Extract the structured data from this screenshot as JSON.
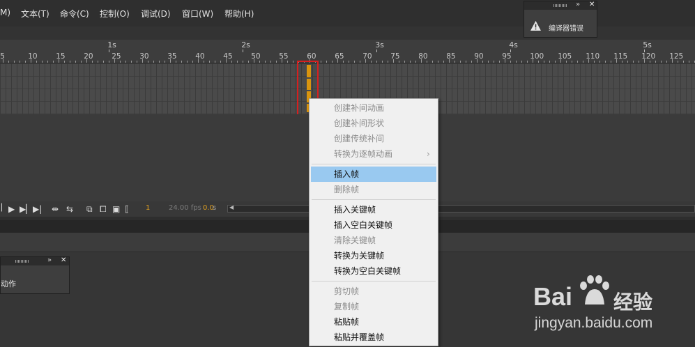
{
  "menu": [
    "M)",
    "文本(T)",
    "命令(C)",
    "控制(O)",
    "调试(D)",
    "窗口(W)",
    "帮助(H)"
  ],
  "ruler": {
    "seconds": [
      "1s",
      "2s",
      "3s",
      "4s",
      "5s"
    ],
    "frames": [
      "5",
      "10",
      "15",
      "20",
      "25",
      "30",
      "35",
      "40",
      "45",
      "50",
      "55",
      "60",
      "65",
      "70",
      "75",
      "80",
      "85",
      "90",
      "95",
      "100",
      "105",
      "110",
      "115",
      "120",
      "125"
    ]
  },
  "controls": {
    "frame": "1",
    "fps": "24.00 fps",
    "time": "0.0",
    "time_unit": "s"
  },
  "compiler_panel": {
    "title": "编译器错误",
    "collapse": "»",
    "close": "✕"
  },
  "actions_panel": {
    "title": "动作",
    "collapse": "»",
    "close": "✕"
  },
  "context_menu": {
    "items": [
      {
        "label": "创建补间动画",
        "enabled": false
      },
      {
        "label": "创建补间形状",
        "enabled": false
      },
      {
        "label": "创建传统补间",
        "enabled": false
      },
      {
        "label": "转换为逐帧动画",
        "enabled": false,
        "submenu": true
      },
      {
        "label": "插入帧",
        "enabled": true,
        "highlighted": true
      },
      {
        "label": "删除帧",
        "enabled": false
      },
      {
        "label": "插入关键帧",
        "enabled": true
      },
      {
        "label": "插入空白关键帧",
        "enabled": true
      },
      {
        "label": "清除关键帧",
        "enabled": false
      },
      {
        "label": "转换为关键帧",
        "enabled": true
      },
      {
        "label": "转换为空白关键帧",
        "enabled": true
      },
      {
        "label": "剪切帧",
        "enabled": false
      },
      {
        "label": "复制帧",
        "enabled": false
      },
      {
        "label": "粘贴帧",
        "enabled": true
      },
      {
        "label": "粘贴并覆盖帧",
        "enabled": true
      }
    ],
    "submenu_arrow": "›"
  },
  "watermark": {
    "brand": "Bai",
    "brand_tail": "经验",
    "url": "jingyan.baidu.com"
  },
  "colors": {
    "playhead": "#d9940e",
    "highlight": "#99c9f0",
    "annotation": "#d61f1f"
  }
}
